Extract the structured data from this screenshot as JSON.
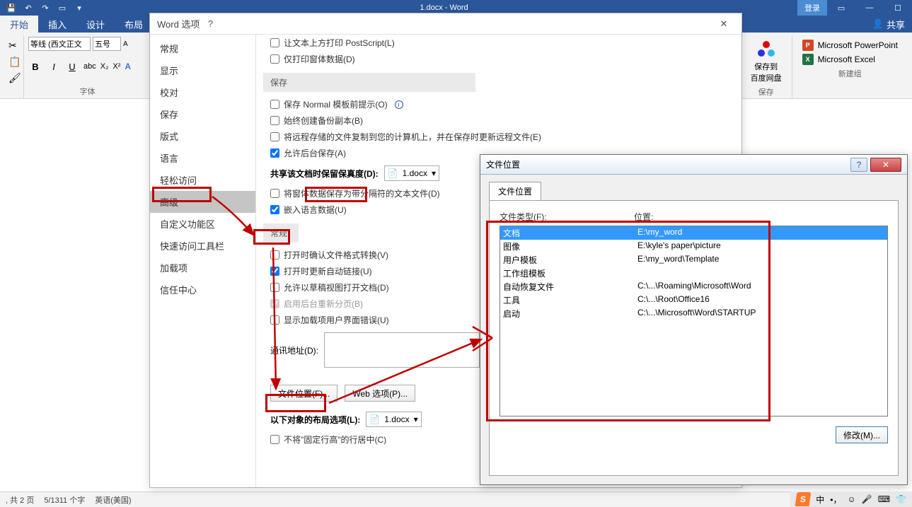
{
  "titlebar": {
    "title": "1.docx - Word",
    "login": "登录"
  },
  "tabs": {
    "start": "开始",
    "insert": "插入",
    "design": "设计",
    "layout": "布局",
    "share": "共享"
  },
  "ribbon": {
    "font_group_label": "字体",
    "font_family": "等线 (西文正文",
    "font_size": "五号",
    "baidu_group_label": "保存",
    "save_baidu": "保存到\n百度网盘",
    "newgroup_label": "新建组",
    "pp": "Microsoft PowerPoint",
    "xl": "Microsoft Excel"
  },
  "options_dlg": {
    "title": "Word 选项",
    "nav": [
      "常规",
      "显示",
      "校对",
      "保存",
      "版式",
      "语言",
      "轻松访问",
      "高级",
      "自定义功能区",
      "快速访问工具栏",
      "加载项",
      "信任中心"
    ],
    "nav_selected": 7,
    "chk_postscript": "让文本上方打印 PostScript(L)",
    "chk_printfontdata": "仅打印窗体数据(D)",
    "sec_save": "保存",
    "save_chk1": "保存 Normal 模板前提示(O)",
    "save_chk2": "始终创建备份副本(B)",
    "save_chk3": "将远程存储的文件复制到您的计算机上，并在保存时更新远程文件(E)",
    "save_chk4": "允许后台保存(A)",
    "share_label": "共享该文档时保留保真度(D):",
    "share_doc": "1.docx",
    "share_chk1": "将窗体数据保存为带分隔符的文本文件(D)",
    "share_chk2": "嵌入语言数据(U)",
    "sec_general": "常规",
    "gen_chk1": "打开时确认文件格式转换(V)",
    "gen_chk2": "打开时更新自动链接(U)",
    "gen_chk3": "允许以草稿视图打开文档(D)",
    "gen_chk4": "启用后台重新分页(B)",
    "gen_chk5": "显示加载项用户界面错误(U)",
    "addr_label": "通讯地址(D):",
    "btn_fileloc": "文件位置(F)...",
    "btn_webopt": "Web 选项(P)...",
    "layout_label": "以下对象的布局选项(L):",
    "layout_doc": "1.docx",
    "layout_chk1": "不将\"固定行高\"的行居中(C)"
  },
  "fileloc": {
    "title": "文件位置",
    "tab": "文件位置",
    "col_type": "文件类型(F):",
    "col_loc": "位置:",
    "rows": [
      {
        "t": "文档",
        "p": "E:\\my_word"
      },
      {
        "t": "图像",
        "p": "E:\\kyle's paper\\picture"
      },
      {
        "t": "用户模板",
        "p": "E:\\my_word\\Template"
      },
      {
        "t": "工作组模板",
        "p": ""
      },
      {
        "t": "自动恢复文件",
        "p": "C:\\...\\Roaming\\Microsoft\\Word"
      },
      {
        "t": "工具",
        "p": "C:\\...\\Root\\Office16"
      },
      {
        "t": "启动",
        "p": "C:\\...\\Microsoft\\Word\\STARTUP"
      }
    ],
    "modify": "修改(M)..."
  },
  "statusbar": {
    "pages": ", 共 2 页",
    "words": "5/1311 个字",
    "lang": "英语(美国)"
  },
  "ime": {
    "lang": "中"
  }
}
